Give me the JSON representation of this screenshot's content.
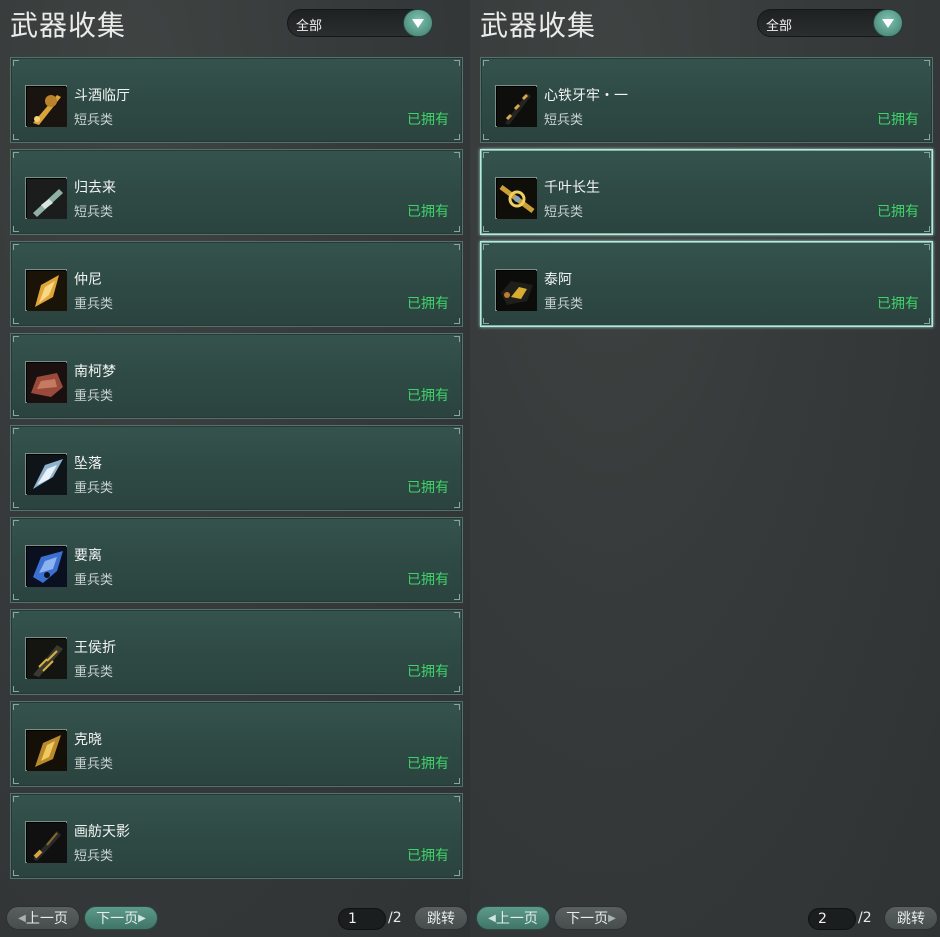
{
  "left_panel": {
    "title": "武器收集",
    "filter_value": "全部",
    "items": [
      {
        "name": "斗酒临厅",
        "category": "短兵类",
        "status": "已拥有",
        "icon": "golden-ornate-sword-icon"
      },
      {
        "name": "归去来",
        "category": "短兵类",
        "status": "已拥有",
        "icon": "jade-blade-icon"
      },
      {
        "name": "仲尼",
        "category": "重兵类",
        "status": "已拥有",
        "icon": "golden-heavy-blade-icon"
      },
      {
        "name": "南柯梦",
        "category": "重兵类",
        "status": "已拥有",
        "icon": "red-heavy-blade-icon"
      },
      {
        "name": "坠落",
        "category": "重兵类",
        "status": "已拥有",
        "icon": "silver-curved-blade-icon"
      },
      {
        "name": "要离",
        "category": "重兵类",
        "status": "已拥有",
        "icon": "blue-heavy-blade-icon"
      },
      {
        "name": "王侯折",
        "category": "重兵类",
        "status": "已拥有",
        "icon": "dark-gold-blade-icon"
      },
      {
        "name": "克晓",
        "category": "重兵类",
        "status": "已拥有",
        "icon": "golden-broad-blade-icon"
      },
      {
        "name": "画舫天影",
        "category": "短兵类",
        "status": "已拥有",
        "icon": "dark-dagger-icon"
      }
    ],
    "pager": {
      "prev": "上一页",
      "next": "下一页",
      "page": "1",
      "total": "/2",
      "jump": "跳转"
    }
  },
  "right_panel": {
    "title": "武器收集",
    "filter_value": "全部",
    "items": [
      {
        "name": "心铁牙牢・一",
        "category": "短兵类",
        "status": "已拥有",
        "icon": "black-gold-sword-icon"
      },
      {
        "name": "千叶长生",
        "category": "短兵类",
        "status": "已拥有",
        "icon": "golden-ring-sword-icon"
      },
      {
        "name": "泰阿",
        "category": "重兵类",
        "status": "已拥有",
        "icon": "black-gold-heavy-blade-icon"
      }
    ],
    "pager": {
      "prev": "上一页",
      "next": "下一页",
      "page": "2",
      "total": "/2",
      "jump": "跳转"
    }
  },
  "colors": {
    "owned": "#3fd46a",
    "card": "#2e4944",
    "accent": "#5d9a8a",
    "selected_border": "#b9e8dd"
  }
}
